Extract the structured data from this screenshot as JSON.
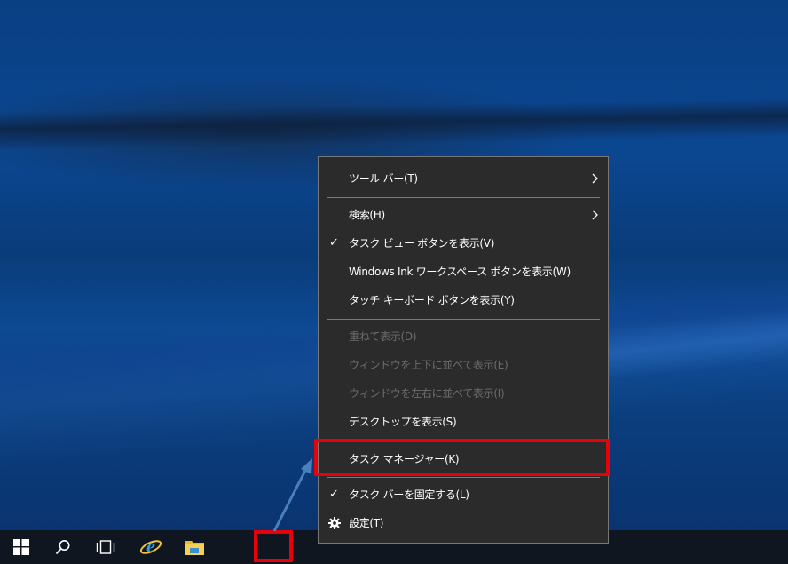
{
  "menu": {
    "items": [
      {
        "label": "ツール バー(T)",
        "submenu": true
      },
      {
        "label": "検索(H)",
        "submenu": true
      },
      {
        "label": "タスク ビュー ボタンを表示(V)",
        "checked": true
      },
      {
        "label": "Windows Ink ワークスペース ボタンを表示(W)"
      },
      {
        "label": "タッチ キーボード ボタンを表示(Y)"
      },
      {
        "label": "重ねて表示(D)",
        "disabled": true
      },
      {
        "label": "ウィンドウを上下に並べて表示(E)",
        "disabled": true
      },
      {
        "label": "ウィンドウを左右に並べて表示(I)",
        "disabled": true
      },
      {
        "label": "デスクトップを表示(S)"
      },
      {
        "label": "タスク マネージャー(K)",
        "highlighted": true
      },
      {
        "label": "タスク バーを固定する(L)",
        "checked": true
      },
      {
        "label": "設定(T)",
        "icon": "gear-icon"
      }
    ]
  },
  "taskbar": {
    "icons": [
      "windows-start-icon",
      "search-icon",
      "task-view-icon",
      "internet-explorer-icon",
      "file-explorer-icon"
    ]
  },
  "colors": {
    "highlight_border": "#e8000a",
    "menu_bg": "#2b2b2b",
    "taskbar_bg": "#0f1620",
    "arrow": "#4a7fc0"
  },
  "symbols": {
    "check": "✓"
  }
}
